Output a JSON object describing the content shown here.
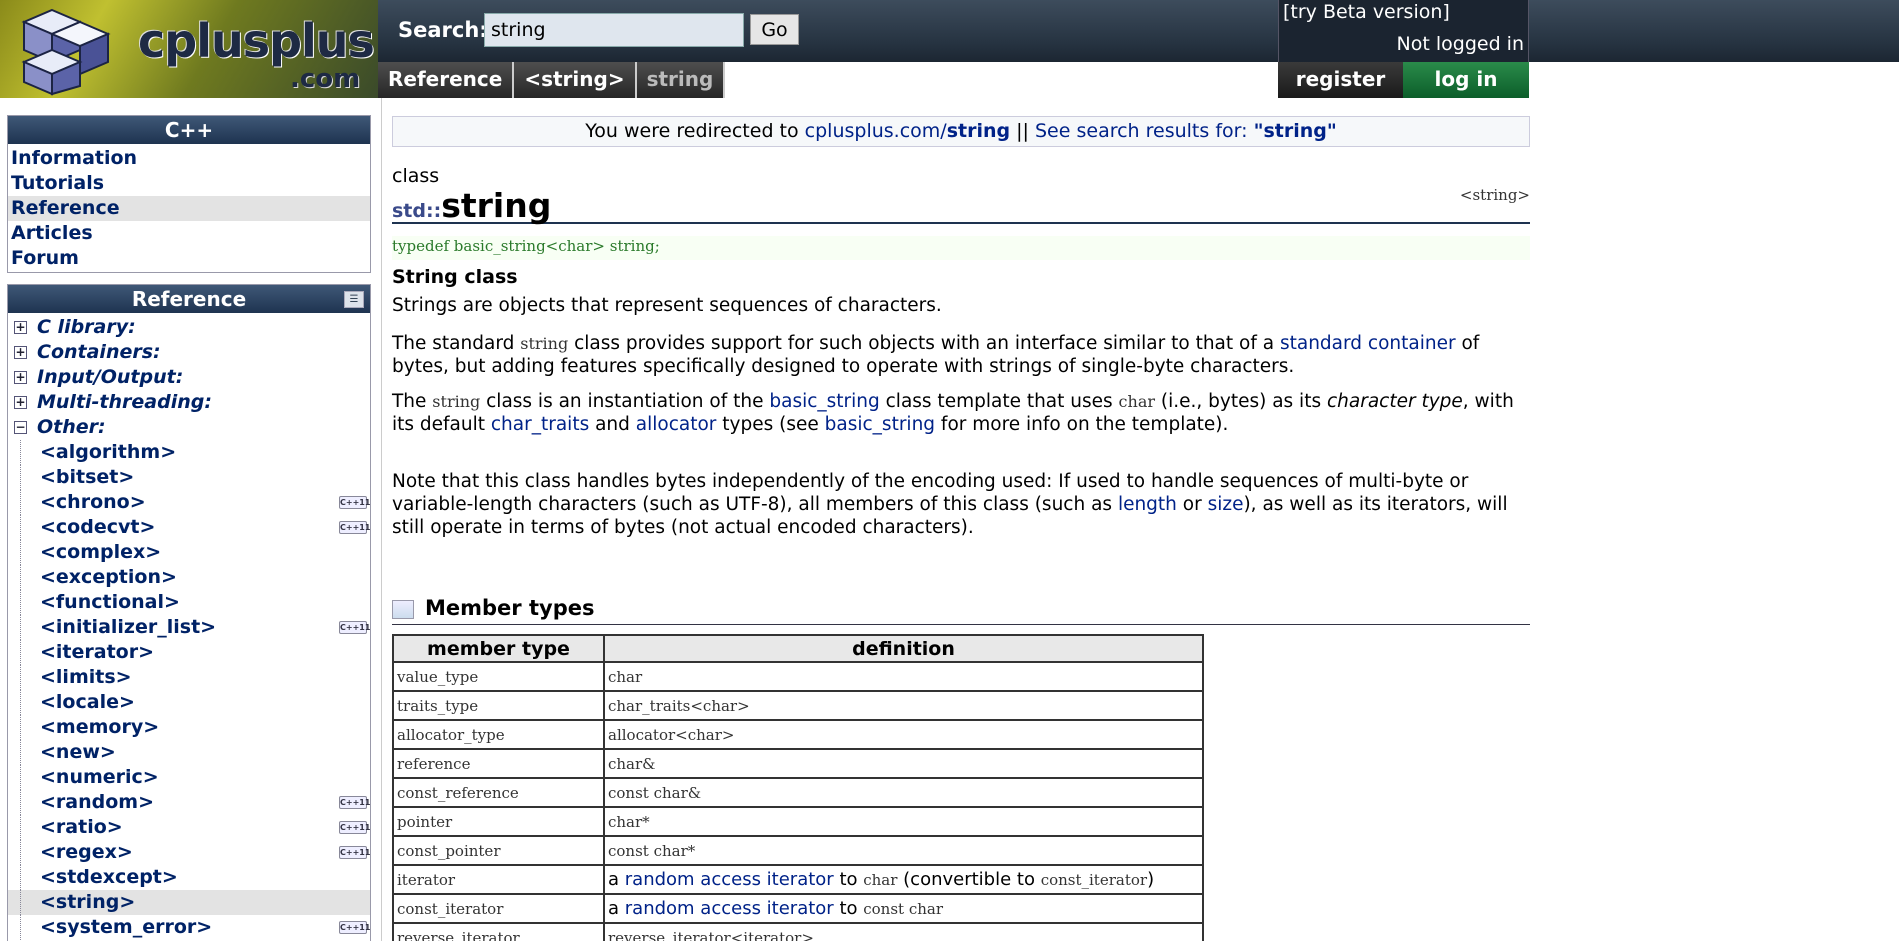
{
  "header": {
    "logo_text": "cplusplus",
    "logo_com": ".com",
    "search_label": "Search:",
    "search_value": "string",
    "go_label": "Go",
    "beta_link": "[try Beta version]",
    "login_status": "Not logged in",
    "register_label": "register",
    "login_label": "log in",
    "breadcrumbs": [
      "Reference",
      "<string>",
      "string"
    ]
  },
  "sidebar": {
    "cpp_box_title": "C++",
    "cpp_items": [
      "Information",
      "Tutorials",
      "Reference",
      "Articles",
      "Forum"
    ],
    "ref_box_title": "Reference",
    "categories": [
      "C library:",
      "Containers:",
      "Input/Output:",
      "Multi-threading:",
      "Other:"
    ],
    "headers": [
      {
        "label": "<algorithm>",
        "cpp11": false
      },
      {
        "label": "<bitset>",
        "cpp11": false
      },
      {
        "label": "<chrono>",
        "cpp11": true
      },
      {
        "label": "<codecvt>",
        "cpp11": true
      },
      {
        "label": "<complex>",
        "cpp11": false
      },
      {
        "label": "<exception>",
        "cpp11": false
      },
      {
        "label": "<functional>",
        "cpp11": false
      },
      {
        "label": "<initializer_list>",
        "cpp11": true
      },
      {
        "label": "<iterator>",
        "cpp11": false
      },
      {
        "label": "<limits>",
        "cpp11": false
      },
      {
        "label": "<locale>",
        "cpp11": false
      },
      {
        "label": "<memory>",
        "cpp11": false
      },
      {
        "label": "<new>",
        "cpp11": false
      },
      {
        "label": "<numeric>",
        "cpp11": false
      },
      {
        "label": "<random>",
        "cpp11": true
      },
      {
        "label": "<ratio>",
        "cpp11": true
      },
      {
        "label": "<regex>",
        "cpp11": true
      },
      {
        "label": "<stdexcept>",
        "cpp11": false
      },
      {
        "label": "<string>",
        "cpp11": false
      },
      {
        "label": "<system_error>",
        "cpp11": true
      }
    ],
    "cpp11_badge": "C++11"
  },
  "main": {
    "redirect_prefix": "You were redirected to ",
    "redirect_link_pre": "cplusplus.com/",
    "redirect_link_bold": "string",
    "redirect_sep": " || ",
    "search_results_text": "See search results for: ",
    "search_results_query": "\"string\"",
    "kind": "class",
    "namespace": "std::",
    "name": "string",
    "header_ref": "<string>",
    "typedef": "typedef basic_string<char> string;",
    "subtitle": "String class",
    "p1": "Strings are objects that represent sequences of characters.",
    "p2": {
      "a": "The standard ",
      "code": "string",
      "b": " class provides support for such objects with an interface similar to that of a ",
      "link": "standard container",
      "c": " of bytes, but adding features specifically designed to operate with strings of single-byte characters."
    },
    "p3": {
      "a": "The ",
      "code1": "string",
      "b": " class is an instantiation of the ",
      "link1": "basic_string",
      "c": " class template that uses ",
      "code2": "char",
      "d": " (i.e., bytes) as its ",
      "em": "character type",
      "e": ", with its default ",
      "link2": "char_traits",
      "f": " and ",
      "link3": "allocator",
      "g": " types (see ",
      "link4": "basic_string",
      "h": " for more info on the template)."
    },
    "p4": {
      "a": "Note that this class handles bytes independently of the encoding used: If used to handle sequences of multi-byte or variable-length characters (such as UTF-8), all members of this class (such as ",
      "link1": "length",
      "b": " or ",
      "link2": "size",
      "c": "), as well as its iterators, will still operate in terms of bytes (not actual encoded characters)."
    },
    "member_types_title": "Member types",
    "table_headers": [
      "member type",
      "definition"
    ],
    "rows": [
      {
        "type": "value_type",
        "def": "char"
      },
      {
        "type": "traits_type",
        "def_link": "char_traits",
        "def_rest": "<char>"
      },
      {
        "type": "allocator_type",
        "def_link": "allocator",
        "def_rest": "<char>"
      },
      {
        "type": "reference",
        "def": "char&"
      },
      {
        "type": "const_reference",
        "def": "const char&"
      },
      {
        "type": "pointer",
        "def": "char*"
      },
      {
        "type": "const_pointer",
        "def": "const char*"
      },
      {
        "type": "iterator",
        "pre": "a ",
        "link": "random access iterator",
        "mid": " to ",
        "code": "char",
        "post": " (convertible to ",
        "code2": "const_iterator",
        "end": ")"
      },
      {
        "type": "const_iterator",
        "pre": "a ",
        "link": "random access iterator",
        "mid": " to ",
        "code": "const char"
      },
      {
        "type": "reverse_iterator",
        "def_link": "reverse_iterator",
        "def_rest": "<iterator>"
      }
    ]
  }
}
